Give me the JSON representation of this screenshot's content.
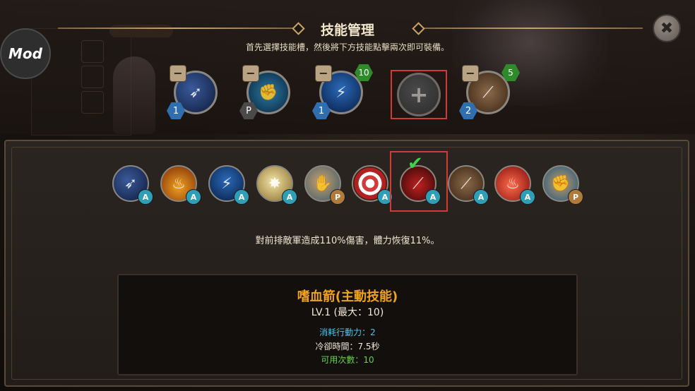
{
  "header": {
    "title": "技能管理",
    "subtitle": "首先選擇技能槽，然後將下方技能點擊兩次即可裝備。",
    "mod_label": "Mod",
    "close_symbol": "✖"
  },
  "equipped_slots": [
    {
      "icon": "arrow-shot-icon",
      "badge": "1",
      "badge_color": "#2f6fb0",
      "minus": "−",
      "count": null
    },
    {
      "icon": "fist-strike-icon",
      "badge": "P",
      "badge_color": "#5a5a5a",
      "minus": "−",
      "count": null
    },
    {
      "icon": "lightning-arrow-icon",
      "badge": "1",
      "badge_color": "#2f6fb0",
      "minus": "−",
      "count": "10"
    },
    {
      "icon": "empty-slot-plus-icon",
      "badge": null,
      "minus": null,
      "count": null,
      "plus": "+"
    },
    {
      "icon": "triple-claw-icon",
      "badge": "2",
      "badge_color": "#2f6fb0",
      "minus": "−",
      "count": "5"
    }
  ],
  "skill_list": [
    {
      "icon": "arrow-shot-icon",
      "type": "A"
    },
    {
      "icon": "fire-claw-icon",
      "type": "A"
    },
    {
      "icon": "lightning-arrow-icon",
      "type": "A"
    },
    {
      "icon": "power-punch-icon",
      "type": "A"
    },
    {
      "icon": "grab-hand-icon",
      "type": "P"
    },
    {
      "icon": "target-icon",
      "type": "A"
    },
    {
      "icon": "blood-arrow-icon",
      "type": "A",
      "selected": true
    },
    {
      "icon": "triple-claw-icon",
      "type": "A"
    },
    {
      "icon": "red-fire-claw-icon",
      "type": "A"
    },
    {
      "icon": "fist-strike-icon",
      "type": "P"
    }
  ],
  "selected_mark": "✔",
  "description": "對前排敵軍造成110%傷害，體力恢復11%。",
  "info": {
    "name": "嗜血箭(主動技能)",
    "level": "LV.1 (最大：10)",
    "cost": "消耗行動力：2",
    "cooldown": "冷卻時間：7.5秒",
    "uses": "可用次數：10"
  },
  "colors": {
    "accent_gold": "#f0a21a",
    "cost_blue": "#4ac6ee",
    "uses_green": "#66d34a",
    "highlight_red": "#d23a3a",
    "active_tag": "#2f9fb8",
    "passive_tag": "#b07a3a"
  }
}
